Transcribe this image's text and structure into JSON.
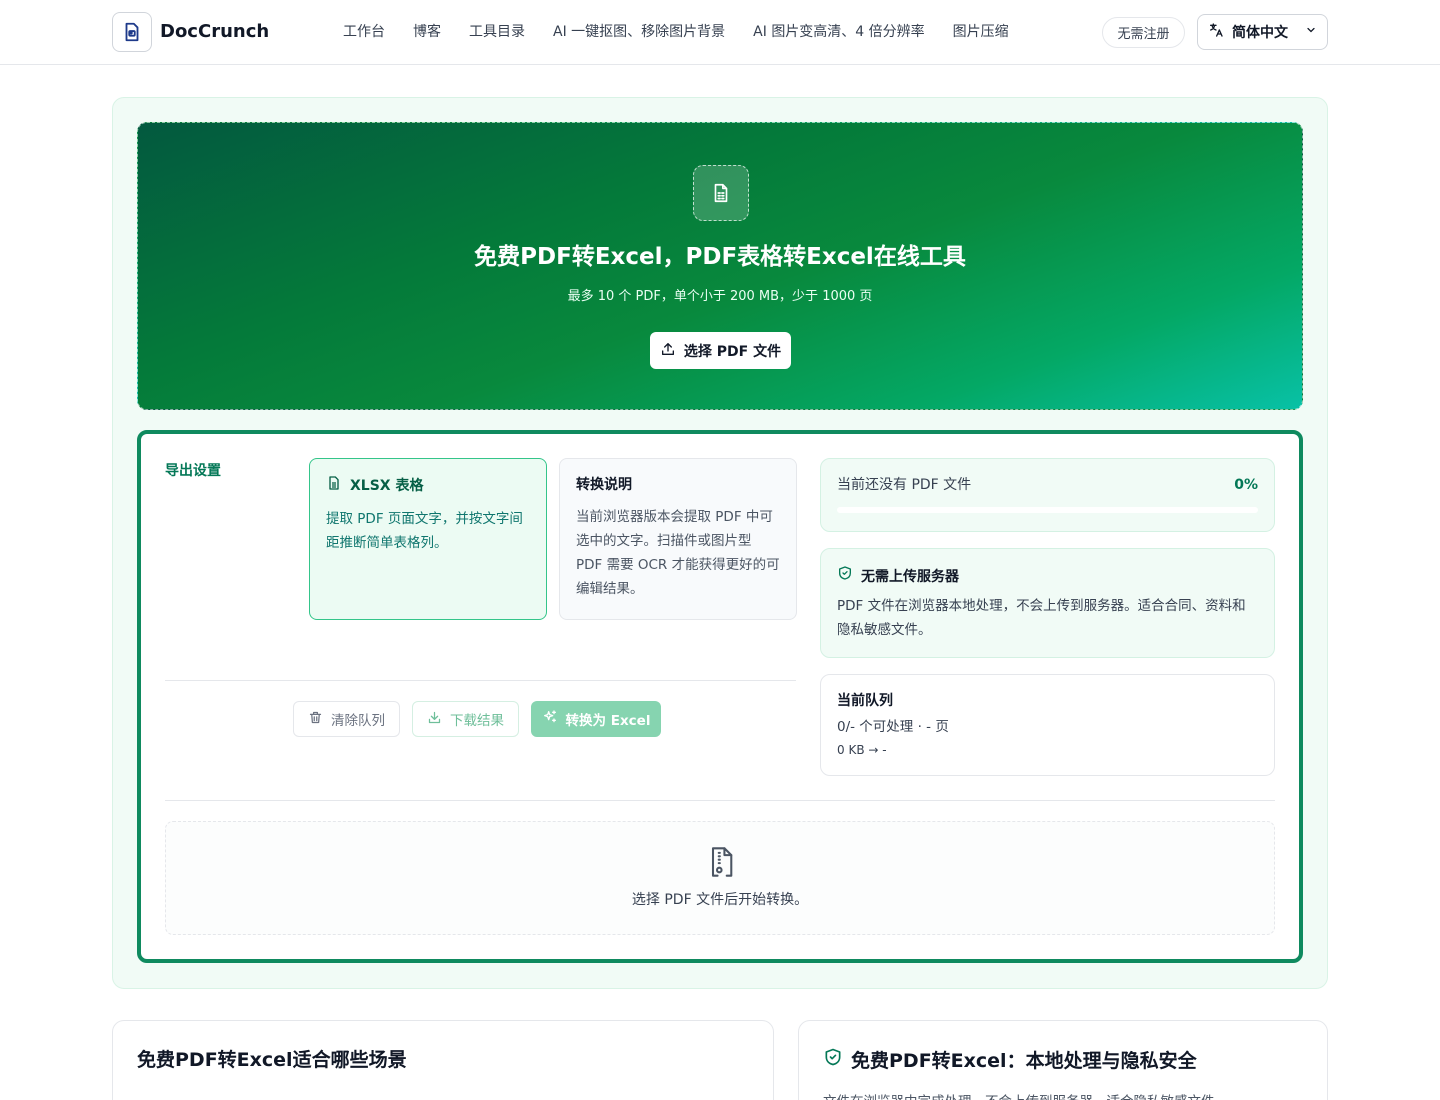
{
  "header": {
    "brand": "DocCrunch",
    "nav": [
      "工作台",
      "博客",
      "工具目录",
      "AI 一键抠图、移除图片背景",
      "AI 图片变高清、4 倍分辨率",
      "图片压缩"
    ],
    "signup": "无需注册",
    "language": "简体中文"
  },
  "hero": {
    "title": "免费PDF转Excel，PDF表格转Excel在线工具",
    "subtitle": "最多 10 个 PDF，单个小于 200 MB，少于 1000 页",
    "button": "选择 PDF 文件"
  },
  "settings": {
    "label": "导出设置",
    "xlsx": {
      "title": "XLSX 表格",
      "desc": "提取 PDF 页面文字，并按文字间距推断简单表格列。"
    },
    "info": {
      "title": "转换说明",
      "desc": "当前浏览器版本会提取 PDF 中可选中的文字。扫描件或图片型 PDF 需要 OCR 才能获得更好的可编辑结果。"
    },
    "actions": {
      "clear": "清除队列",
      "download": "下载结果",
      "convert": "转换为 Excel"
    },
    "progress": {
      "status": "当前还没有 PDF 文件",
      "percent": "0%",
      "fraction": 0
    },
    "privacy": {
      "title": "无需上传服务器",
      "desc": "PDF 文件在浏览器本地处理，不会上传到服务器。适合合同、资料和隐私敏感文件。"
    },
    "queue": {
      "title": "当前队列",
      "line": "0/- 个可处理 · - 页",
      "size": "0 KB → -"
    },
    "empty": "选择 PDF 文件后开始转换。"
  },
  "bottom": {
    "left_title": "免费PDF转Excel适合哪些场景",
    "left_text": "",
    "right_title": "免费PDF转Excel：本地处理与隐私安全",
    "right_text": "文件在浏览器中完成处理，不会上传到服务器，适合隐私敏感文件。"
  },
  "colors": {
    "accent": "#0f8a5f",
    "accent_light": "#86d4b0",
    "hero_start": "#03593f",
    "hero_end": "#08c1a6"
  }
}
